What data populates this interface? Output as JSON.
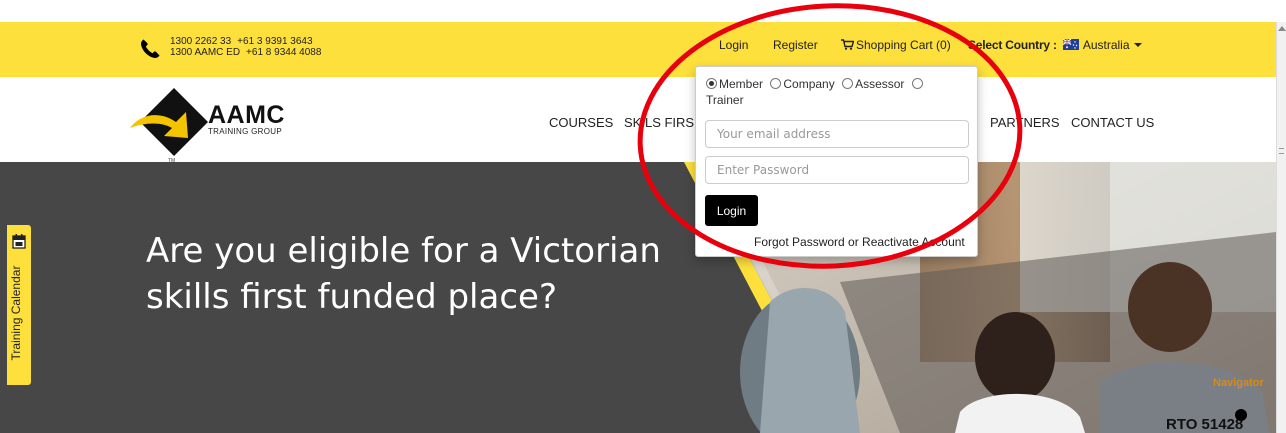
{
  "topbar": {
    "phones": [
      [
        "1300 2262 33",
        "+61 3 9391 3643"
      ],
      [
        "1300 AAMC ED",
        "+61 8 9344 4088"
      ]
    ],
    "login": "Login",
    "register": "Register",
    "cart": "Shopping Cart (0)",
    "select_country": "Select Country :",
    "country": "Australia",
    "accent_color": "#fde03c"
  },
  "logo": {
    "name": "AAMC",
    "tagline": "TRAINING GROUP"
  },
  "nav": {
    "items": [
      "COURSES",
      "SKILLS FIRST",
      "PARTNERS",
      "CONTACT US"
    ],
    "visible_fragments": [
      "COURSES",
      "SKI",
      "LS FIRS",
      "PART",
      "NERS",
      "CONTACT US"
    ]
  },
  "login_panel": {
    "roles": [
      "Member",
      "Company",
      "Assessor",
      "Trainer"
    ],
    "selected_role": "Member",
    "email_placeholder": "Your email address",
    "password_placeholder": "Enter Password",
    "login_button": "Login",
    "forgot_link": "Forgot Password or Reactivate Account"
  },
  "hero": {
    "title": "Are you eligible for a Victorian skills first funded place?",
    "rto": "RTO 51428",
    "navigator": "Navigator"
  },
  "side_tab": {
    "label": "Training Calendar",
    "icon": "calendar-icon"
  },
  "annotation": {
    "color": "#e8000d"
  }
}
